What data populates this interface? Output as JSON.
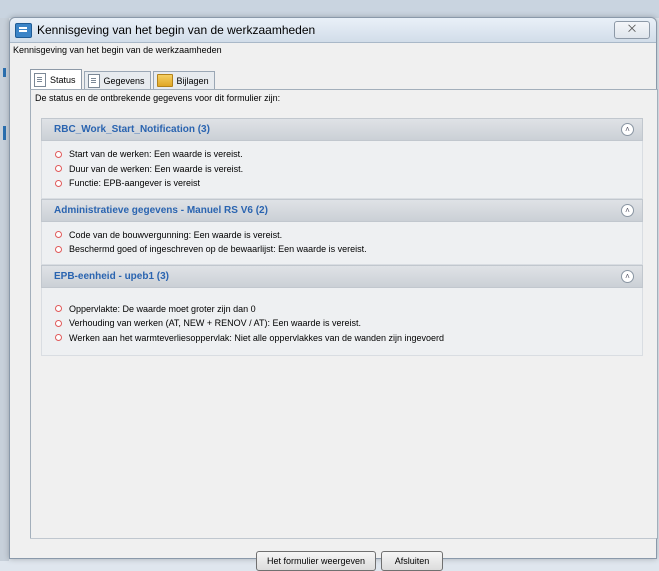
{
  "window": {
    "title": "Kennisgeving van het begin van de werkzaamheden",
    "subtitle": "Kennisgeving van het begin van de werkzaamheden",
    "close_glyph": "⨉"
  },
  "tabs": [
    {
      "label": "Status",
      "icon": "document-icon",
      "active": true
    },
    {
      "label": "Gegevens",
      "icon": "document-icon",
      "active": false
    },
    {
      "label": "Bijlagen",
      "icon": "folder-icon",
      "active": false
    }
  ],
  "panel": {
    "heading": "De status en de ontbrekende gegevens voor dit formulier zijn:"
  },
  "sections": [
    {
      "title": "RBC_Work_Start_Notification (3)",
      "items": [
        "Start van de werken: Een waarde is vereist.",
        "Duur van de werken: Een waarde is vereist.",
        "Functie: EPB-aangever is vereist"
      ]
    },
    {
      "title": "Administratieve gegevens - Manuel RS V6 (2)",
      "items": [
        "Code van de bouwvergunning: Een waarde is vereist.",
        "Beschermd goed of ingeschreven op de bewaarlijst: Een waarde is vereist."
      ]
    },
    {
      "title": "EPB-eenheid - upeb1 (3)",
      "items": [
        "Oppervlakte: De waarde moet groter zijn dan 0",
        "Verhouding van werken (AT, NEW + RENOV / AT): Een waarde is vereist.",
        "Werken aan het warmteverliesoppervlak: Niet alle oppervlakkes van de wanden zijn ingevoerd"
      ]
    }
  ],
  "footer": {
    "show_form_label": "Het formulier weergeven",
    "close_label": "Afsluiten"
  },
  "colors": {
    "section_title": "#2a64b0",
    "bullet": "#e05a5a"
  }
}
